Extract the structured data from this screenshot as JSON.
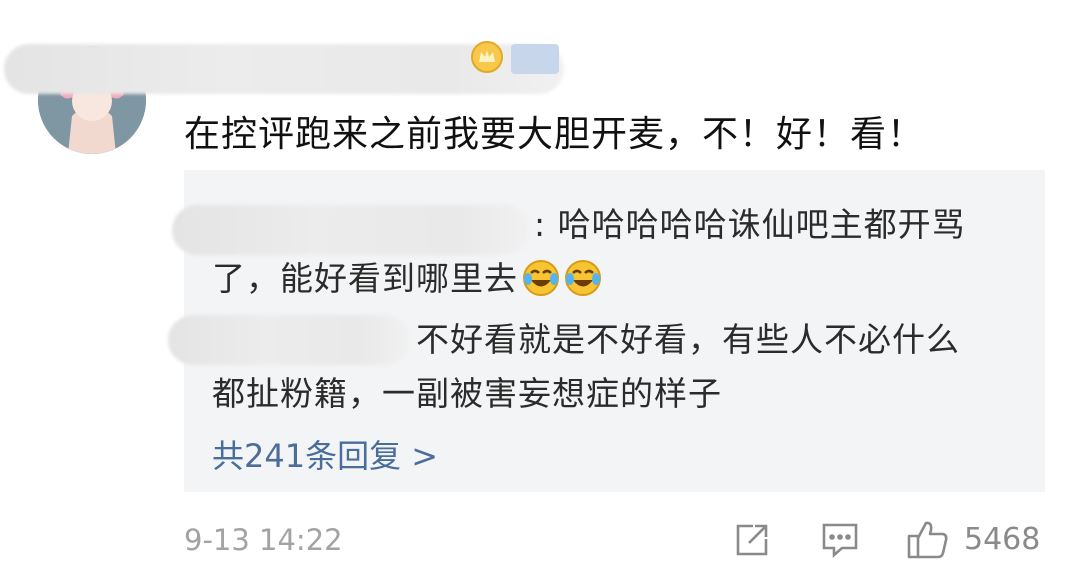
{
  "comment": {
    "text": "在控评跑来之前我要大胆开麦，不！好！看！",
    "timestamp": "9-13 14:22",
    "likes": "5468"
  },
  "replies": [
    {
      "line1": ": 哈哈哈哈哈诛仙吧主都开骂",
      "line2": "了，能好看到哪里去"
    },
    {
      "line1": "不好看就是不好看，有些人不必什么",
      "line2": "都扯粉籍，一副被害妄想症的样子"
    }
  ],
  "more_replies": "共241条回复 >",
  "icons": {
    "avatar": "avatar",
    "crown": "crown-icon",
    "verified": "verified-badge",
    "laugh_emoji": "laughing-crying-emoji",
    "share": "share-icon",
    "comment": "comment-icon",
    "like": "thumbs-up-icon"
  },
  "colors": {
    "link": "#4a6d99",
    "reply_bg": "#f3f4f6",
    "meta": "#a3a3a3"
  }
}
